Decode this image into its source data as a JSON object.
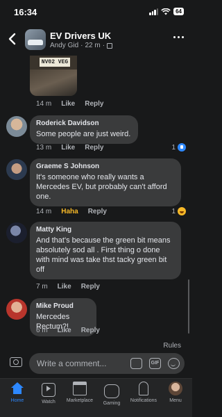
{
  "status_bar": {
    "time": "16:34",
    "battery": "64"
  },
  "header": {
    "title": "EV Drivers UK",
    "subtitle_author": "Andy Gid",
    "subtitle_time": "22 m"
  },
  "post_image": {
    "plate_text": "NV02 VEG"
  },
  "top_meta": {
    "time": "14 m",
    "like": "Like",
    "reply": "Reply"
  },
  "comments": [
    {
      "name": "Roderick Davidson",
      "text": "Some people are just weird.",
      "time": "13 m",
      "action": "Like",
      "reply": "Reply",
      "reaction_count": "1",
      "reaction": "like-icon"
    },
    {
      "name": "Graeme S Johnson",
      "text": "It's someone who really wants a Mercedes EV, but probably can't afford one.",
      "time": "14 m",
      "action": "Haha",
      "reply": "Reply",
      "reaction_count": "1",
      "reaction": "haha-icon"
    },
    {
      "name": "Matty King",
      "text": "And that's because the green bit means absolutely sod all . First thing o done with mind was take thst tacky green bit off",
      "time": "7 m",
      "action": "Like",
      "reply": "Reply"
    },
    {
      "name": "Mike Proud",
      "text": "Mercedes Rectum?!",
      "time": "6 m",
      "action": "Like",
      "reply": "Reply"
    }
  ],
  "composer": {
    "rules": "Rules",
    "placeholder": "Write a comment...",
    "gif": "GIF"
  },
  "tabs": [
    {
      "label": "Home",
      "icon": "home-icon",
      "active": true
    },
    {
      "label": "Watch",
      "icon": "watch-icon"
    },
    {
      "label": "Marketplace",
      "icon": "marketplace-icon"
    },
    {
      "label": "Gaming",
      "icon": "gaming-icon"
    },
    {
      "label": "Notifications",
      "icon": "notifications-icon"
    },
    {
      "label": "Menu",
      "icon": "menu-avatar"
    }
  ],
  "colors": {
    "accent": "#2d88ff",
    "haha": "#f7b928",
    "background": "#18191a",
    "bubble": "#3a3b3c"
  }
}
